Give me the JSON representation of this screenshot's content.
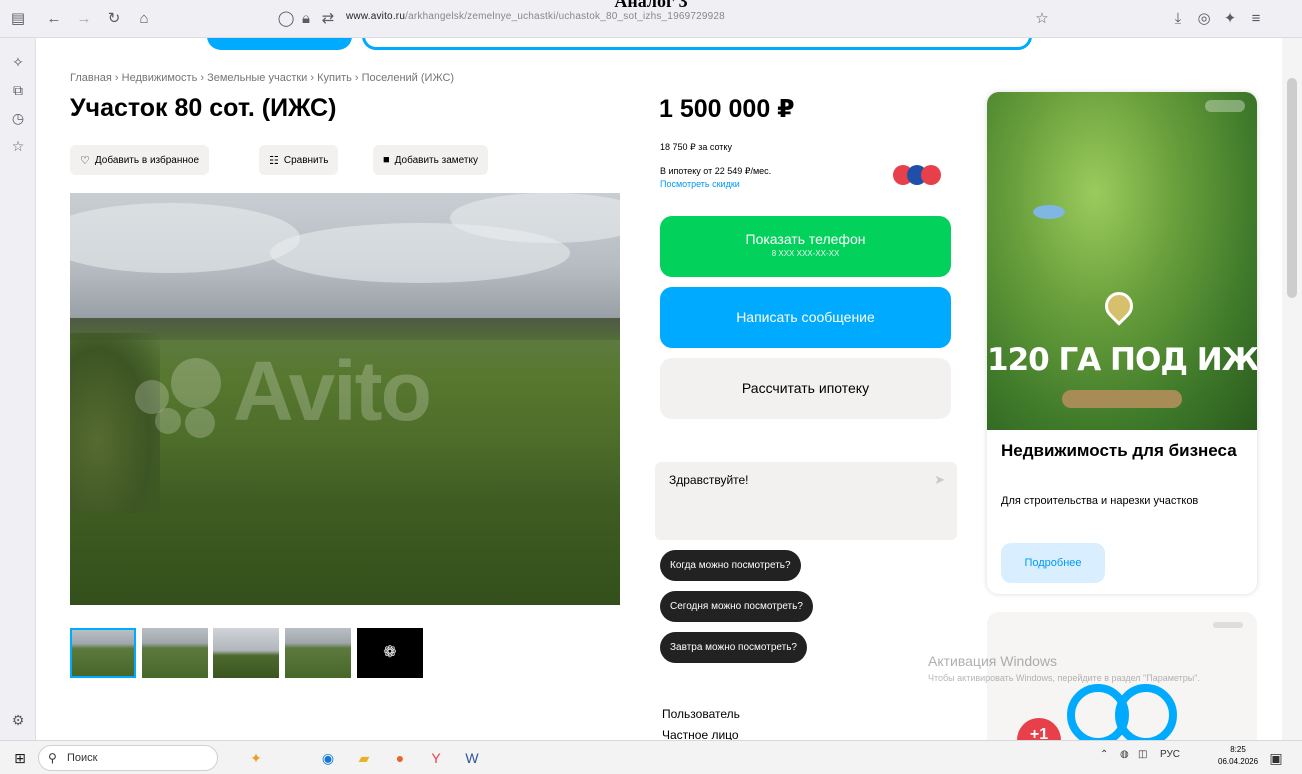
{
  "doc_caption": "Аналог 3",
  "browser": {
    "url_domain": "www.avito.ru",
    "url_path": "/arkhangelsk/zemelnye_uchastki/uchastok_80_sot_izhs_1969729928"
  },
  "breadcrumb": "Главная › Недвижимость › Земельные участки › Купить › Поселений (ИЖС)",
  "listing": {
    "title": "Участок 80 сот. (ИЖС)",
    "actions": {
      "favorite": "Добавить в избранное",
      "compare": "Сравнить",
      "note": "Добавить заметку"
    },
    "watermark": "Avito",
    "price": "1 500 000 ₽",
    "price_per_sotka": "18 750 ₽ за сотку",
    "mortgage": "В ипотеку от 22 549 ₽/мес.",
    "discounts_link": "Посмотреть скидки",
    "show_phone": "Показать телефон",
    "phone_masked": "8 XXX XXX-XX-XX",
    "write_message": "Написать сообщение",
    "calc_mortgage": "Рассчитать ипотеку",
    "message_text": "Здравствуйте!",
    "quick_replies": [
      "Когда можно посмотреть?",
      "Сегодня можно посмотреть?",
      "Завтра можно посмотреть?"
    ],
    "seller_label": "Пользователь",
    "seller_type": "Частное лицо"
  },
  "ad": {
    "headline": "120 ГА ПОД ИЖС",
    "title": "Недвижимость для бизнеса",
    "description": "Для строительства и нарезки участков",
    "button": "Подробнее",
    "badge": "+1"
  },
  "windows_activation": {
    "title": "Активация Windows",
    "subtitle": "Чтобы активировать Windows, перейдите в раздел \"Параметры\"."
  },
  "taskbar": {
    "search_placeholder": "Поиск",
    "lang": "РУС",
    "time": "8:25",
    "date": "06.04.2026"
  },
  "colors": {
    "accent_blue": "#00aaff",
    "accent_green": "#02d15c",
    "chip_dark": "#222222"
  }
}
